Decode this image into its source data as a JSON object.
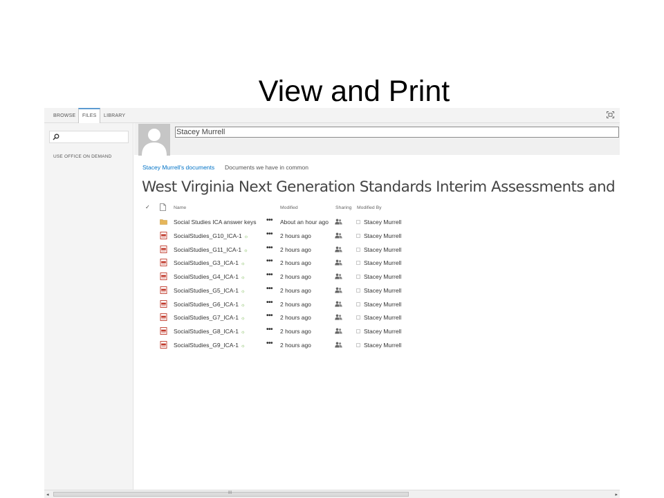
{
  "slide": {
    "title": "View and Print"
  },
  "ribbon": {
    "tabs": [
      {
        "label": "BROWSE",
        "active": false
      },
      {
        "label": "FILES",
        "active": true
      },
      {
        "label": "LIBRARY",
        "active": false
      }
    ],
    "focus_icon": "focus-on-content-icon"
  },
  "leftnav": {
    "search_placeholder": "",
    "search_icon": "search-icon",
    "office_on_demand": "USE OFFICE ON DEMAND"
  },
  "profile": {
    "name": "Stacey Murrell",
    "avatar_icon": "person-avatar-icon"
  },
  "links": {
    "mine": "Stacey Murrell's documents",
    "common": "Documents we have in common"
  },
  "library": {
    "title": "West Virginia Next Generation Standards Interim Assessments and Resources",
    "columns": {
      "check": "✓",
      "name": "Name",
      "modified": "Modified",
      "sharing": "Sharing",
      "modified_by": "Modified By"
    },
    "new_marker": "☼",
    "rows": [
      {
        "type": "folder",
        "name": "Social Studies ICA answer keys",
        "is_new": false,
        "modified": "About an hour ago",
        "modified_by": "Stacey Murrell"
      },
      {
        "type": "pdf",
        "name": "SocialStudies_G10_ICA-1",
        "is_new": true,
        "modified": "2 hours ago",
        "modified_by": "Stacey Murrell"
      },
      {
        "type": "pdf",
        "name": "SocialStudies_G11_ICA-1",
        "is_new": true,
        "modified": "2 hours ago",
        "modified_by": "Stacey Murrell"
      },
      {
        "type": "pdf",
        "name": "SocialStudies_G3_ICA-1",
        "is_new": true,
        "modified": "2 hours ago",
        "modified_by": "Stacey Murrell"
      },
      {
        "type": "pdf",
        "name": "SocialStudies_G4_ICA-1",
        "is_new": true,
        "modified": "2 hours ago",
        "modified_by": "Stacey Murrell"
      },
      {
        "type": "pdf",
        "name": "SocialStudies_G5_ICA-1",
        "is_new": true,
        "modified": "2 hours ago",
        "modified_by": "Stacey Murrell"
      },
      {
        "type": "pdf",
        "name": "SocialStudies_G6_ICA-1",
        "is_new": true,
        "modified": "2 hours ago",
        "modified_by": "Stacey Murrell"
      },
      {
        "type": "pdf",
        "name": "SocialStudies_G7_ICA-1",
        "is_new": true,
        "modified": "2 hours ago",
        "modified_by": "Stacey Murrell"
      },
      {
        "type": "pdf",
        "name": "SocialStudies_G8_ICA-1",
        "is_new": true,
        "modified": "2 hours ago",
        "modified_by": "Stacey Murrell"
      },
      {
        "type": "pdf",
        "name": "SocialStudies_G9_ICA-1",
        "is_new": true,
        "modified": "2 hours ago",
        "modified_by": "Stacey Murrell"
      }
    ]
  },
  "scrollbar": {
    "left_arrow": "◂",
    "right_arrow": "▸",
    "grip": "III"
  },
  "colors": {
    "link": "#0072c6",
    "folder": "#e6b65a",
    "pdf": "#c0392b",
    "new_marker": "#5aa72a",
    "tab_accent": "#5c9bd1"
  }
}
